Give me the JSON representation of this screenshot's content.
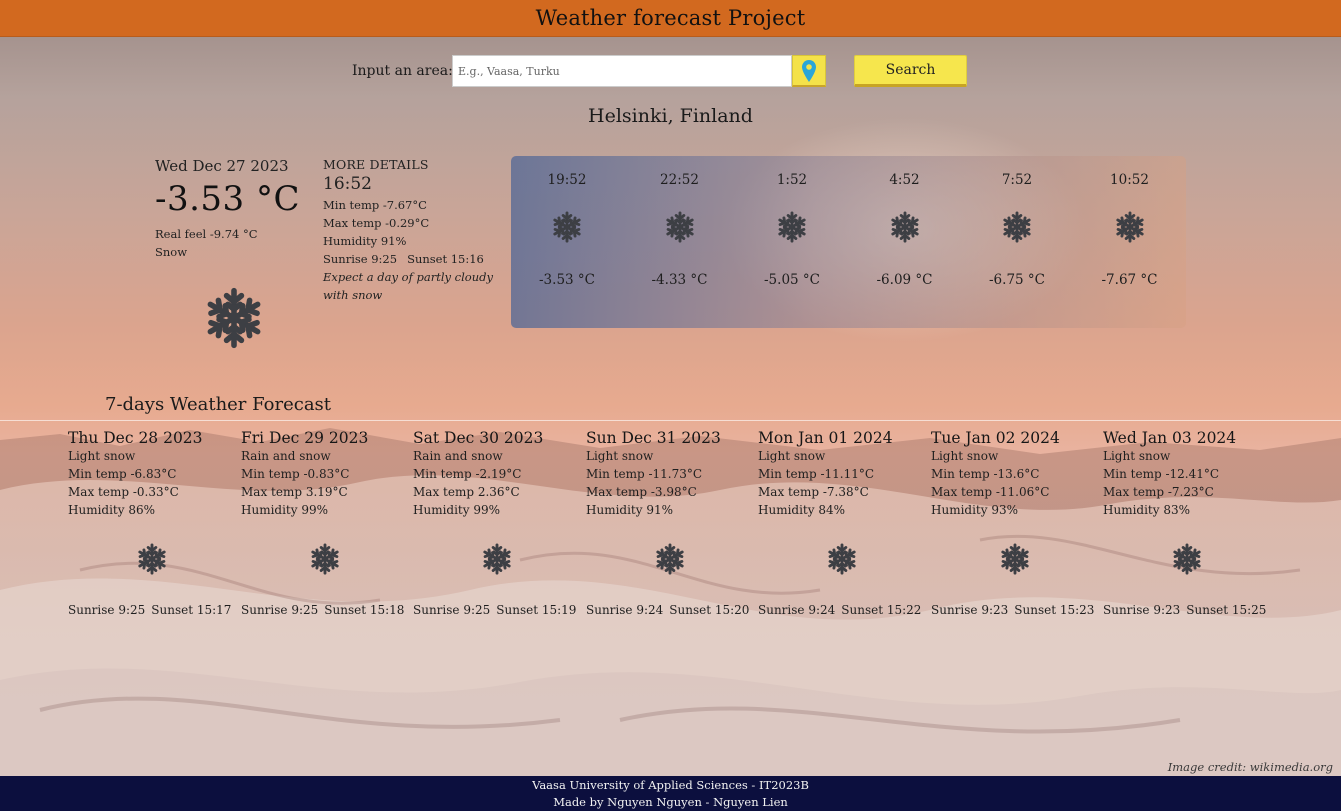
{
  "header": {
    "title": "Weather forecast Project"
  },
  "search": {
    "label": "Input an area:",
    "placeholder": "E.g., Vaasa, Turku",
    "value": "",
    "button_label": "Search",
    "location_icon": "location-pin-icon"
  },
  "location": "Helsinki, Finland",
  "current": {
    "date": "Wed Dec 27 2023",
    "temp": "-3.53 °C",
    "real_feel": "Real feel -9.74 °C",
    "condition": "Snow",
    "icon": "snowflake-icon"
  },
  "details": {
    "heading": "MORE DETAILS",
    "time": "16:52",
    "min_temp": "Min temp -7.67°C",
    "max_temp": "Max temp -0.29°C",
    "humidity": "Humidity 91%",
    "sunrise": "Sunrise 9:25",
    "sunset": "Sunset 15:16",
    "summary": "Expect a day of partly cloudy with snow"
  },
  "hourly": [
    {
      "time": "19:52",
      "temp": "-3.53 °C",
      "icon": "snowflake-icon"
    },
    {
      "time": "22:52",
      "temp": "-4.33 °C",
      "icon": "snowflake-icon"
    },
    {
      "time": "1:52",
      "temp": "-5.05 °C",
      "icon": "snowflake-icon"
    },
    {
      "time": "4:52",
      "temp": "-6.09 °C",
      "icon": "snowflake-icon"
    },
    {
      "time": "7:52",
      "temp": "-6.75 °C",
      "icon": "snowflake-icon"
    },
    {
      "time": "10:52",
      "temp": "-7.67 °C",
      "icon": "snowflake-icon"
    }
  ],
  "forecast": {
    "title": "7-days Weather Forecast",
    "days": [
      {
        "date": "Thu Dec 28 2023",
        "condition": "Light snow",
        "min": "Min temp -6.83°C",
        "max": "Max temp -0.33°C",
        "humidity": "Humidity 86%",
        "sunrise": "Sunrise 9:25",
        "sunset": "Sunset 15:17",
        "icon": "snowflake-icon"
      },
      {
        "date": "Fri Dec 29 2023",
        "condition": "Rain and snow",
        "min": "Min temp -0.83°C",
        "max": "Max temp 3.19°C",
        "humidity": "Humidity 99%",
        "sunrise": "Sunrise 9:25",
        "sunset": "Sunset 15:18",
        "icon": "snowflake-icon"
      },
      {
        "date": "Sat Dec 30 2023",
        "condition": "Rain and snow",
        "min": "Min temp -2.19°C",
        "max": "Max temp 2.36°C",
        "humidity": "Humidity 99%",
        "sunrise": "Sunrise 9:25",
        "sunset": "Sunset 15:19",
        "icon": "snowflake-icon"
      },
      {
        "date": "Sun Dec 31 2023",
        "condition": "Light snow",
        "min": "Min temp -11.73°C",
        "max": "Max temp -3.98°C",
        "humidity": "Humidity 91%",
        "sunrise": "Sunrise 9:24",
        "sunset": "Sunset 15:20",
        "icon": "snowflake-icon"
      },
      {
        "date": "Mon Jan 01 2024",
        "condition": "Light snow",
        "min": "Min temp -11.11°C",
        "max": "Max temp -7.38°C",
        "humidity": "Humidity 84%",
        "sunrise": "Sunrise 9:24",
        "sunset": "Sunset 15:22",
        "icon": "snowflake-icon"
      },
      {
        "date": "Tue Jan 02 2024",
        "condition": "Light snow",
        "min": "Min temp -13.6°C",
        "max": "Max temp -11.06°C",
        "humidity": "Humidity 93%",
        "sunrise": "Sunrise 9:23",
        "sunset": "Sunset 15:23",
        "icon": "snowflake-icon"
      },
      {
        "date": "Wed Jan 03 2024",
        "condition": "Light snow",
        "min": "Min temp -12.41°C",
        "max": "Max temp -7.23°C",
        "humidity": "Humidity 83%",
        "sunrise": "Sunrise 9:23",
        "sunset": "Sunset 15:25",
        "icon": "snowflake-icon"
      }
    ]
  },
  "credit": "Image credit: wikimedia.org",
  "footer": {
    "line1": "Vaasa University of Applied Sciences - IT2023B",
    "line2": "Made by Nguyen Nguyen - Nguyen Lien"
  },
  "colors": {
    "header_bg": "#d2691f",
    "button_yellow": "#f6e64d",
    "footer_bg": "#0c0f3e",
    "icon_gray": "#3d3f44",
    "pin_blue": "#2aa6d8"
  }
}
